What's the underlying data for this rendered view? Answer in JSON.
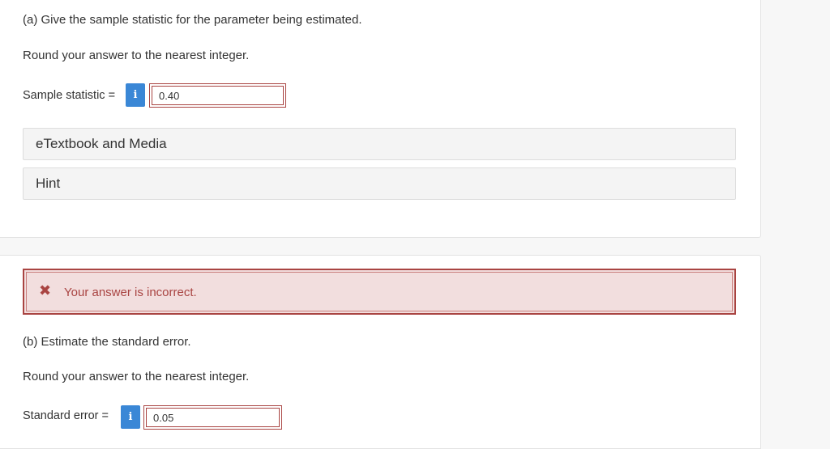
{
  "part_a": {
    "question": "(a) Give the sample statistic for the parameter being estimated.",
    "instruction": "Round your answer to the nearest integer.",
    "field_label": "Sample statistic =",
    "info_icon": "i",
    "answer_value": "0.40",
    "panels": [
      {
        "label": "eTextbook and Media"
      },
      {
        "label": "Hint"
      }
    ]
  },
  "part_b": {
    "alert_icon": "✖",
    "alert_text": "Your answer is incorrect.",
    "question": "(b) Estimate the standard error.",
    "instruction": "Round your answer to the nearest integer.",
    "field_label": "Standard error =",
    "info_icon": "i",
    "answer_value": "0.05"
  },
  "colors": {
    "error_red": "#a94442",
    "error_bg": "#f2dede",
    "info_blue": "#3a87d6",
    "panel_bg": "#f4f4f4"
  }
}
